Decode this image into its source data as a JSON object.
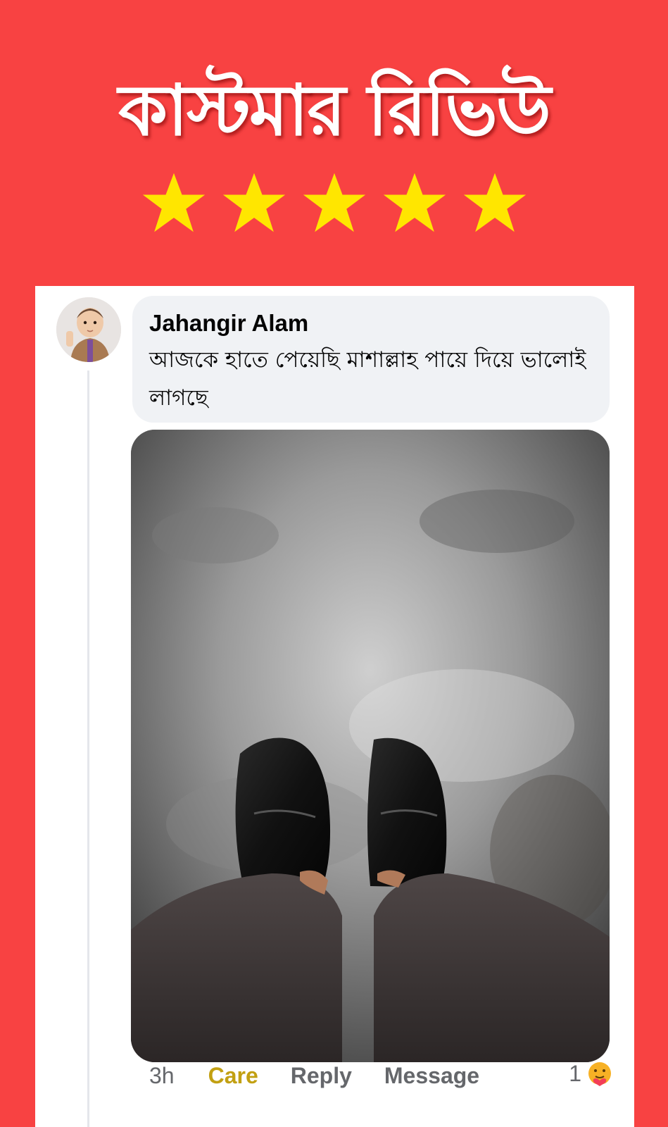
{
  "banner": {
    "title": "কাস্টমার রিভিউ",
    "rating": 5,
    "star_color": "#ffe600",
    "background_color": "#f84242"
  },
  "comment": {
    "author": "Jahangir Alam",
    "text": "আজকে হাতে পেয়েছি মাশাল্লাহ পায়ে দিয়ে ভালোই লাগছে",
    "avatar_icon": "profile-photo",
    "photo_icon": "customer-photo-black-loafers"
  },
  "actions": {
    "time": "3h",
    "care": "Care",
    "reply": "Reply",
    "message": "Message",
    "reaction_count": "1",
    "reaction_icon": "care-emoji"
  },
  "colors": {
    "care_label": "#c2a012",
    "muted_text": "#65676b",
    "bubble_bg": "#f0f2f5"
  }
}
